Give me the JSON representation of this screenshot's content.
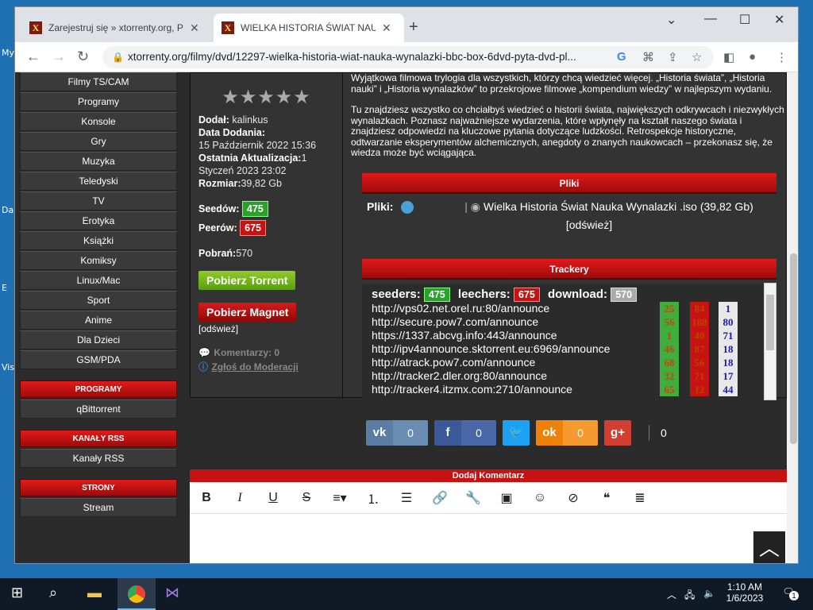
{
  "desktop": {
    "labels": [
      "My",
      "Da",
      "E",
      "Vis"
    ]
  },
  "browser": {
    "tabs": [
      {
        "favicon": "X",
        "title": "Zarejestruj się » xtorrenty.org, PC",
        "active": false
      },
      {
        "favicon": "X",
        "title": "WIELKA HISTORIA ŚWIAT NAUKA",
        "active": true
      }
    ],
    "url": "xtorrenty.org/filmy/dvd/12297-wielka-historia-wiat-nauka-wynalazki-bbc-box-6dvd-pyta-dvd-pl..."
  },
  "sidebar": {
    "items": [
      "Filmy TS/CAM",
      "Programy",
      "Konsole",
      "Gry",
      "Muzyka",
      "Teledyski",
      "TV",
      "Erotyka",
      "Książki",
      "Komiksy",
      "Linux/Mac",
      "Sport",
      "Anime",
      "Dla Dzieci",
      "GSM/PDA"
    ],
    "sections": [
      {
        "title": "PROGRAMY",
        "item": "qBittorrent"
      },
      {
        "title": "KANAŁY RSS",
        "item": "Kanały RSS"
      },
      {
        "title": "STRONY",
        "item": "Stream"
      }
    ]
  },
  "info": {
    "stars": "★★★★★",
    "added_by_label": "Dodał:",
    "added_by": "kalinkus",
    "date_label": "Data Dodania:",
    "date": "15 Październik 2022 15:36",
    "update_label": "Ostatnia Aktualizacja:",
    "update": "1 Styczeń 2023 23:02",
    "size_label": "Rozmiar:",
    "size": "39,82 Gb",
    "seeds_label": "Seedów:",
    "seeds": "475",
    "peers_label": "Peerów:",
    "peers": "675",
    "downloads_label": "Pobrań:",
    "downloads": "570",
    "download_torrent": "Pobierz Torrent",
    "download_magnet": "Pobierz Magnet",
    "refresh": "[odśwież]",
    "comments": "Komentarzy: 0",
    "report": "Zgłoś do Moderacji"
  },
  "description": {
    "p1": "Wyjątkowa filmowa trylogia dla wszystkich, którzy chcą wiedzieć więcej. „Historia świata”, „Historia nauki” i „Historia wynalazków” to przekrojowe filmowe „kompendium wiedzy” w najlepszym wydaniu.",
    "p2": "Tu znajdziesz wszystko co chciałbyś wiedzieć o historii świata, największych odkrywcach i niezwykłych wynalazkach. Poznasz najważniejsze wydarzenia, które wpłynęły na kształt naszego świata i znajdziesz odpowiedzi na kluczowe pytania dotyczące ludzkości. Retrospekcje historyczne, odtwarzanie eksperymentów alchemicznych, anegdoty o znanych naukowcach – przekonasz się, że wiedza może być wciągająca."
  },
  "files": {
    "header": "Pliki",
    "label": "Pliki:",
    "file": "Wielka Historia Świat Nauka Wynalazki .iso (39,82 Gb)",
    "refresh": "[odśwież]"
  },
  "trackers": {
    "header": "Trackery",
    "seeders_label": "seeders:",
    "seeders": "475",
    "leechers_label": "leechers:",
    "leechers": "675",
    "download_label": "download:",
    "download": "570",
    "rows": [
      {
        "url": "http://vps02.net.orel.ru:80/announce",
        "s": "25",
        "l": "84",
        "d": "1"
      },
      {
        "url": "http://secure.pow7.com/announce",
        "s": "56",
        "l": "188",
        "d": "80"
      },
      {
        "url": "https://1337.abcvg.info:443/announce",
        "s": "1",
        "l": "40",
        "d": "71"
      },
      {
        "url": "http://ipv4announce.sktorrent.eu:6969/announce",
        "s": "46",
        "l": "87",
        "d": "18"
      },
      {
        "url": "http://atrack.pow7.com/announce",
        "s": "68",
        "l": "56",
        "d": "18"
      },
      {
        "url": "http://tracker2.dler.org:80/announce",
        "s": "32",
        "l": "71",
        "d": "17"
      },
      {
        "url": "http://tracker4.itzmx.com:2710/announce",
        "s": "65",
        "l": "12",
        "d": "44"
      }
    ]
  },
  "share": {
    "vk": "0",
    "fb": "0",
    "ok": "0",
    "total": "0"
  },
  "comment": {
    "header": "Dodaj Komentarz"
  },
  "taskbar": {
    "time": "1:10 AM",
    "date": "1/6/2023",
    "notifications": "1"
  }
}
